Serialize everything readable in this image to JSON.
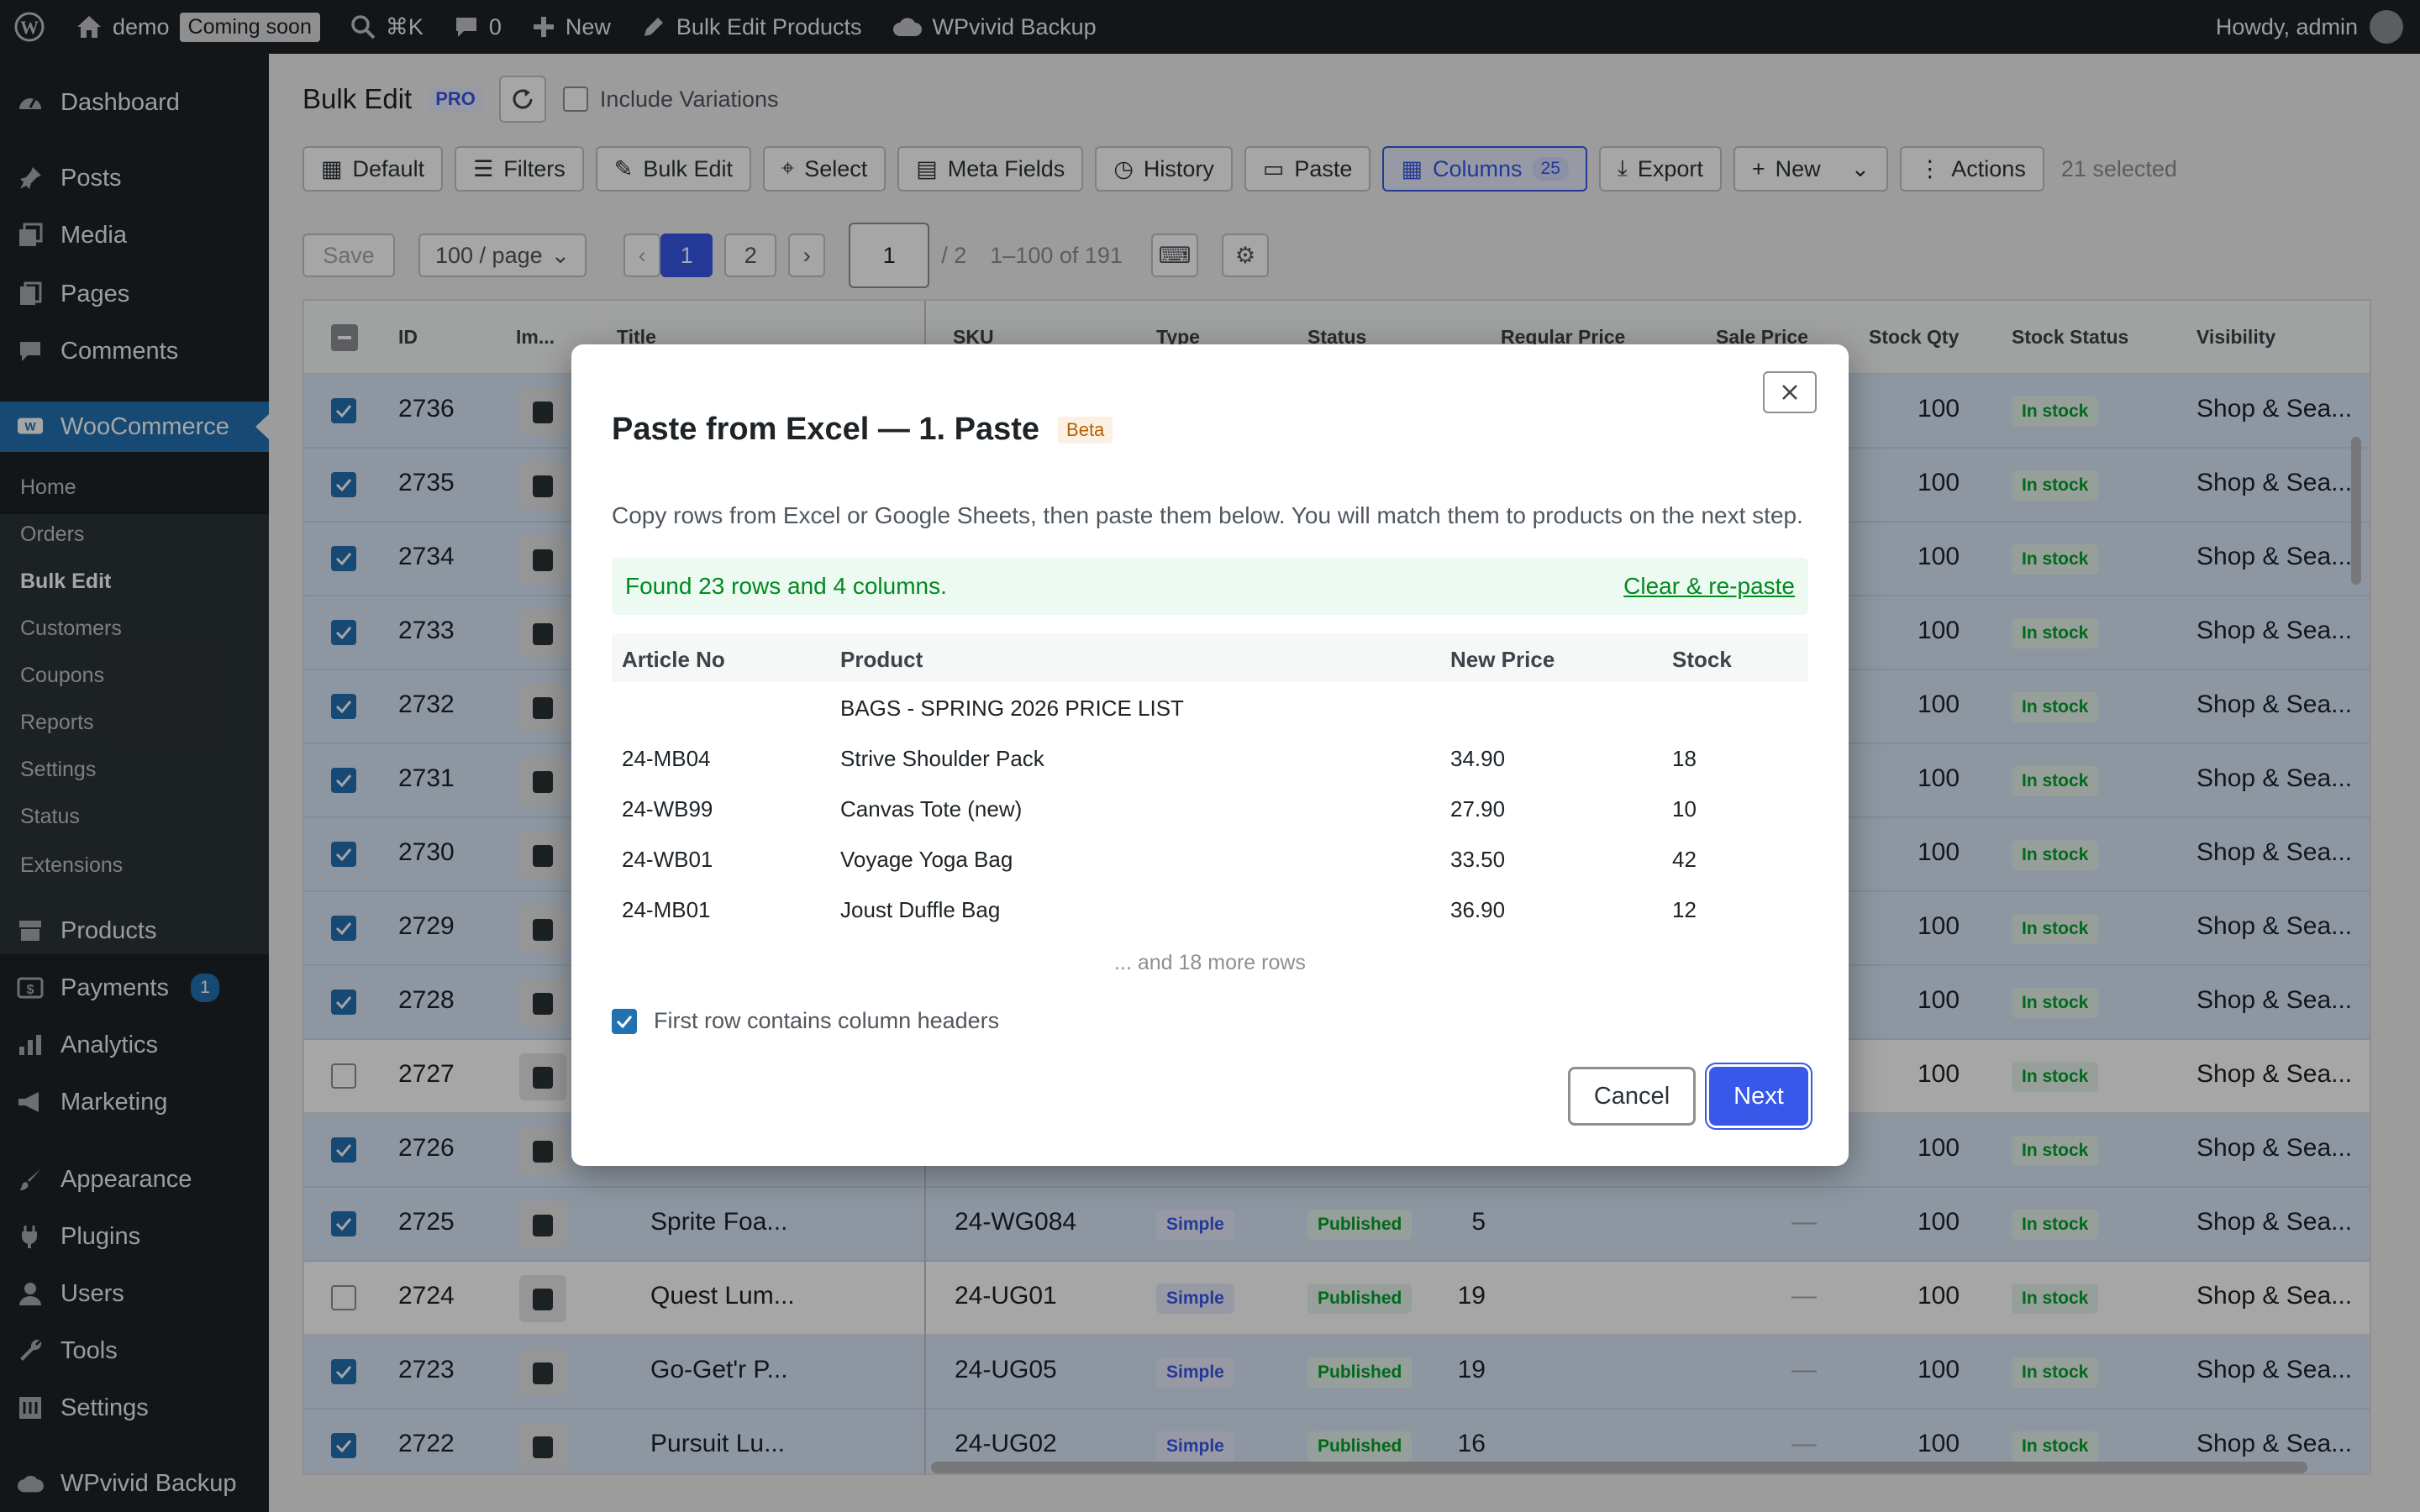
{
  "admin_bar": {
    "site": "demo",
    "coming_soon": "Coming soon",
    "search_shortcut": "⌘K",
    "comments": "0",
    "new": "New",
    "bulk_edit": "Bulk Edit Products",
    "backup": "WPvivid Backup",
    "howdy": "Howdy, admin"
  },
  "sidebar": {
    "items": [
      "Dashboard",
      "Posts",
      "Media",
      "Pages",
      "Comments",
      "WooCommerce",
      "Products",
      "Payments",
      "Analytics",
      "Marketing",
      "Appearance",
      "Plugins",
      "Users",
      "Tools",
      "Settings",
      "WPvivid Backup"
    ],
    "payments_badge": "1",
    "woo_sub": [
      "Home",
      "Orders",
      "Bulk Edit",
      "Customers",
      "Coupons",
      "Reports",
      "Settings",
      "Status",
      "Extensions"
    ]
  },
  "header": {
    "title": "Bulk Edit",
    "pro": "PRO",
    "include_variations": "Include Variations"
  },
  "toolbar": {
    "default": "Default",
    "filters": "Filters",
    "bulk_edit": "Bulk Edit",
    "select": "Select",
    "meta_fields": "Meta Fields",
    "history": "History",
    "paste": "Paste",
    "columns": "Columns",
    "columns_count": "25",
    "export": "Export",
    "new": "New",
    "actions": "Actions",
    "selected": "21 selected"
  },
  "pager": {
    "save": "Save",
    "per_page": "100 / page",
    "prev": "‹",
    "page1": "1",
    "page2": "2",
    "next": "›",
    "page_input": "1",
    "of": "/ 2",
    "range": "1–100 of 191"
  },
  "grid": {
    "headers": [
      "ID",
      "Im...",
      "Title",
      "SKU",
      "Type",
      "Status",
      "Regular Price",
      "Sale Price",
      "Stock Qty",
      "Stock Status",
      "Visibility"
    ],
    "rows": [
      {
        "id": "2736",
        "checked": true,
        "title": "",
        "sku": "",
        "type": "",
        "status": "",
        "price": "",
        "sale": "",
        "qty": "100",
        "stock": "In stock",
        "vis": "Shop & Sea..."
      },
      {
        "id": "2735",
        "checked": true,
        "title": "",
        "sku": "",
        "type": "",
        "status": "",
        "price": "",
        "sale": "",
        "qty": "100",
        "stock": "In stock",
        "vis": "Shop & Sea..."
      },
      {
        "id": "2734",
        "checked": true,
        "title": "",
        "sku": "",
        "type": "",
        "status": "",
        "price": "",
        "sale": "",
        "qty": "100",
        "stock": "In stock",
        "vis": "Shop & Sea..."
      },
      {
        "id": "2733",
        "checked": true,
        "title": "",
        "sku": "",
        "type": "",
        "status": "",
        "price": "",
        "sale": "",
        "qty": "100",
        "stock": "In stock",
        "vis": "Shop & Sea..."
      },
      {
        "id": "2732",
        "checked": true,
        "title": "",
        "sku": "",
        "type": "",
        "status": "",
        "price": "",
        "sale": "",
        "qty": "100",
        "stock": "In stock",
        "vis": "Shop & Sea..."
      },
      {
        "id": "2731",
        "checked": true,
        "title": "",
        "sku": "",
        "type": "",
        "status": "",
        "price": "",
        "sale": "",
        "qty": "100",
        "stock": "In stock",
        "vis": "Shop & Sea..."
      },
      {
        "id": "2730",
        "checked": true,
        "title": "",
        "sku": "",
        "type": "",
        "status": "",
        "price": "",
        "sale": "",
        "qty": "100",
        "stock": "In stock",
        "vis": "Shop & Sea..."
      },
      {
        "id": "2729",
        "checked": true,
        "title": "",
        "sku": "",
        "type": "",
        "status": "",
        "price": "",
        "sale": "",
        "qty": "100",
        "stock": "In stock",
        "vis": "Shop & Sea..."
      },
      {
        "id": "2728",
        "checked": true,
        "title": "",
        "sku": "",
        "type": "",
        "status": "",
        "price": "",
        "sale": "",
        "qty": "100",
        "stock": "In stock",
        "vis": "Shop & Sea..."
      },
      {
        "id": "2727",
        "checked": false,
        "title": "",
        "sku": "",
        "type": "",
        "status": "",
        "price": "",
        "sale": "",
        "qty": "100",
        "stock": "In stock",
        "vis": "Shop & Sea..."
      },
      {
        "id": "2726",
        "checked": true,
        "title": "",
        "sku": "",
        "type": "",
        "status": "",
        "price": "",
        "sale": "",
        "qty": "100",
        "stock": "In stock",
        "vis": "Shop & Sea..."
      },
      {
        "id": "2725",
        "checked": true,
        "title": "Sprite Foa...",
        "sku": "24-WG084",
        "type": "Simple",
        "status": "Published",
        "price": "5",
        "sale": "—",
        "qty": "100",
        "stock": "In stock",
        "vis": "Shop & Sea..."
      },
      {
        "id": "2724",
        "checked": false,
        "title": "Quest Lum...",
        "sku": "24-UG01",
        "type": "Simple",
        "status": "Published",
        "price": "19",
        "sale": "—",
        "qty": "100",
        "stock": "In stock",
        "vis": "Shop & Sea..."
      },
      {
        "id": "2723",
        "checked": true,
        "title": "Go-Get'r P...",
        "sku": "24-UG05",
        "type": "Simple",
        "status": "Published",
        "price": "19",
        "sale": "—",
        "qty": "100",
        "stock": "In stock",
        "vis": "Shop & Sea..."
      },
      {
        "id": "2722",
        "checked": true,
        "title": "Pursuit Lu...",
        "sku": "24-UG02",
        "type": "Simple",
        "status": "Published",
        "price": "16",
        "sale": "—",
        "qty": "100",
        "stock": "In stock",
        "vis": "Shop & Sea..."
      }
    ]
  },
  "modal": {
    "title": "Paste from Excel — 1. Paste",
    "beta": "Beta",
    "description": "Copy rows from Excel or Google Sheets, then paste them below. You will match them to products on the next step.",
    "found": "Found 23 rows and 4 columns.",
    "clear": "Clear & re-paste",
    "headers": [
      "Article No",
      "Product",
      "New Price",
      "Stock"
    ],
    "rows": [
      [
        "",
        "BAGS - SPRING 2026 PRICE LIST",
        "",
        ""
      ],
      [
        "24-MB04",
        "Strive Shoulder Pack",
        "34.90",
        "18"
      ],
      [
        "24-WB99",
        "Canvas Tote (new)",
        "27.90",
        "10"
      ],
      [
        "24-WB01",
        "Voyage Yoga Bag",
        "33.50",
        "42"
      ],
      [
        "24-MB01",
        "Joust Duffle Bag",
        "36.90",
        "12"
      ]
    ],
    "more": "... and 18 more rows",
    "first_row_headers": "First row contains column headers",
    "cancel": "Cancel",
    "next": "Next"
  }
}
